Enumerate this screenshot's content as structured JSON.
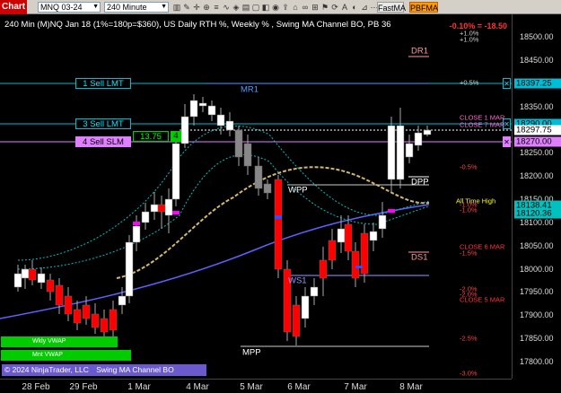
{
  "toolbar": {
    "chart_tab": "Chart",
    "instrument": "MNQ 03-24",
    "interval": "240 Minute",
    "btn_fastma": "FastMA",
    "btn_pbfma": "PBFMA"
  },
  "header": {
    "title": "240 Min (M)NQ Jan 18 (1%=180p=$360), US Daily RTH %, Weekly % , Swing MA Channel BO, PB 36",
    "pct_change": "-0.10% = -18.50"
  },
  "colors": {
    "bull": "#ffffff",
    "bear": "#ff0000",
    "order_line": "#00bcd4",
    "sell_slm": "#e080ff",
    "fast_ma": "#d4b870",
    "slow_ma": "#6060ff",
    "channel": "#00c0c0"
  },
  "orders": [
    {
      "label": "1 Sell LMT",
      "price": "18397.25"
    },
    {
      "label": "3 Sell LMT",
      "price": "18297.75"
    },
    {
      "label": "4 Sell SLM",
      "price": "18270.00"
    }
  ],
  "entry_box": {
    "value": "13.75",
    "qty": "4"
  },
  "levels": {
    "dr1": "DR1",
    "mr1": "MR1",
    "dpp": "DPP",
    "wpp": "WPP",
    "ds1": "DS1",
    "ws1": "WS1",
    "mpp": "MPP",
    "close1": "CLOSE 1 MAR",
    "close7": "CLOSE 7 MAR",
    "close6": "CLOSE 6 MAR",
    "close5": "CLOSE 5 MAR",
    "ath": "All Time High"
  },
  "pct_labels": {
    "p1a": "+1.0%",
    "p1b": "+1.0%",
    "p05": "+0.5%",
    "m05": "-0.5%",
    "m10a": "-1.0%",
    "m10b": "-1.0%",
    "m15": "-1.5%",
    "m20a": "-2.0%",
    "m20b": "-2.0%",
    "m25": "-2.5%",
    "m30": "-3.0%"
  },
  "price_axis": [
    "18500.00",
    "18450.00",
    "18400.00",
    "18350.00",
    "18300.00",
    "18250.00",
    "18200.00",
    "18150.00",
    "18100.00",
    "18050.00",
    "18000.00",
    "17950.00",
    "17900.00",
    "17850.00",
    "17800.00"
  ],
  "price_tags": [
    {
      "text": "18397.25",
      "bg": "#00bcd4",
      "fg": "#000000"
    },
    {
      "text": "18290.00",
      "bg": "#00bcd4",
      "fg": "#000000"
    },
    {
      "text": "18297.75",
      "bg": "#ffffff",
      "fg": "#000000"
    },
    {
      "text": "18270.00",
      "bg": "#e080ff",
      "fg": "#000000"
    },
    {
      "text": "18138.41",
      "bg": "#00c0c0",
      "fg": "#000000"
    },
    {
      "text": "18120.36",
      "bg": "#00c0c0",
      "fg": "#000000"
    }
  ],
  "time_axis": [
    "28 Feb",
    "29 Feb",
    "1 Mar",
    "4 Mar",
    "5 Mar",
    "6 Mar",
    "7 Mar",
    "8 Mar"
  ],
  "vwap": {
    "weekly": "Wkly VWAP",
    "monthly": "Mnt VWAP"
  },
  "copyright": "© 2024 NinjaTrader, LLC",
  "swing_label": "Swing MA Channel BO"
}
